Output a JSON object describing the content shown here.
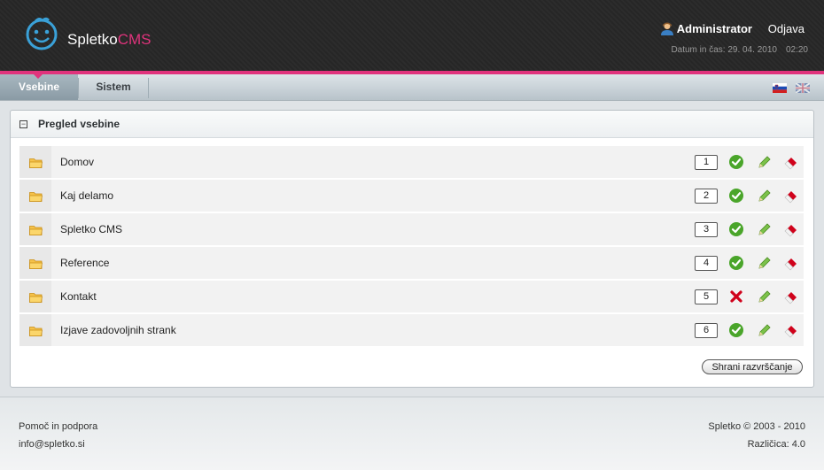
{
  "brand": {
    "name": "Spletko",
    "suffix": "CMS"
  },
  "header": {
    "user": "Administrator",
    "logout": "Odjava",
    "datetime_label": "Datum in čas: 29. 04. 2010",
    "time": "02:20"
  },
  "nav": {
    "tabs": [
      {
        "label": "Vsebine"
      },
      {
        "label": "Sistem"
      }
    ]
  },
  "panel": {
    "title": "Pregled vsebine",
    "rows": [
      {
        "label": "Domov",
        "order": "1",
        "status": "active"
      },
      {
        "label": "Kaj delamo",
        "order": "2",
        "status": "active"
      },
      {
        "label": "Spletko CMS",
        "order": "3",
        "status": "active"
      },
      {
        "label": "Reference",
        "order": "4",
        "status": "active"
      },
      {
        "label": "Kontakt",
        "order": "5",
        "status": "inactive"
      },
      {
        "label": "Izjave zadovoljnih strank",
        "order": "6",
        "status": "active"
      }
    ],
    "save_label": "Shrani razvrščanje"
  },
  "footer": {
    "help": "Pomoč in podpora",
    "email": "info@spletko.si",
    "copyright": "Spletko © 2003 - 2010",
    "version": "Različica: 4.0"
  },
  "colors": {
    "accent": "#e0337c",
    "logo_blue": "#3aa1d8",
    "check_green": "#4aa52a",
    "delete_red": "#d0021b"
  }
}
